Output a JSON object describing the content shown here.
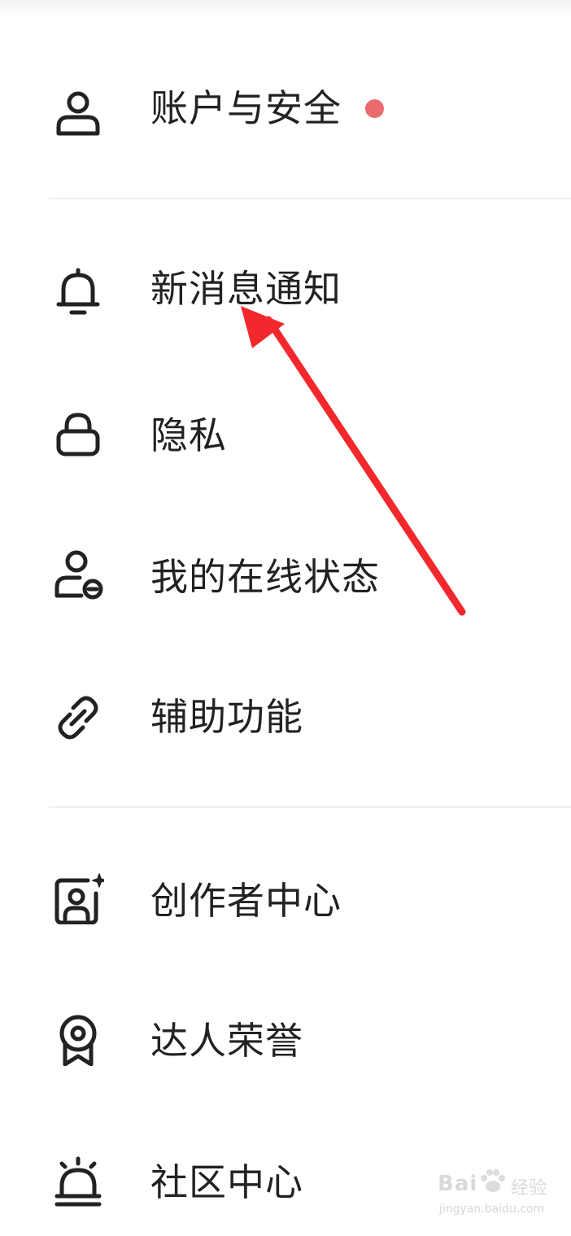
{
  "settings_menu": {
    "items": [
      {
        "label": "账户与安全",
        "icon": "user-icon",
        "has_badge": true
      },
      {
        "label": "新消息通知",
        "icon": "bell-icon",
        "has_badge": false
      },
      {
        "label": "隐私",
        "icon": "lock-icon",
        "has_badge": false
      },
      {
        "label": "我的在线状态",
        "icon": "user-status-icon",
        "has_badge": false
      },
      {
        "label": "辅助功能",
        "icon": "link-icon",
        "has_badge": false
      },
      {
        "label": "创作者中心",
        "icon": "creator-portrait-icon",
        "has_badge": false
      },
      {
        "label": "达人荣誉",
        "icon": "award-badge-icon",
        "has_badge": false
      },
      {
        "label": "社区中心",
        "icon": "siren-icon",
        "has_badge": false
      }
    ]
  },
  "colors": {
    "badge_dot": "#e96b6e",
    "annotation_arrow": "#f2282d",
    "divider": "#f0f0f0",
    "text": "#222222"
  },
  "annotation": {
    "type": "arrow",
    "points_to": "新消息通知"
  },
  "watermark": {
    "brand": "Bai",
    "service": "经验",
    "url": "jingyan.baidu.com"
  }
}
